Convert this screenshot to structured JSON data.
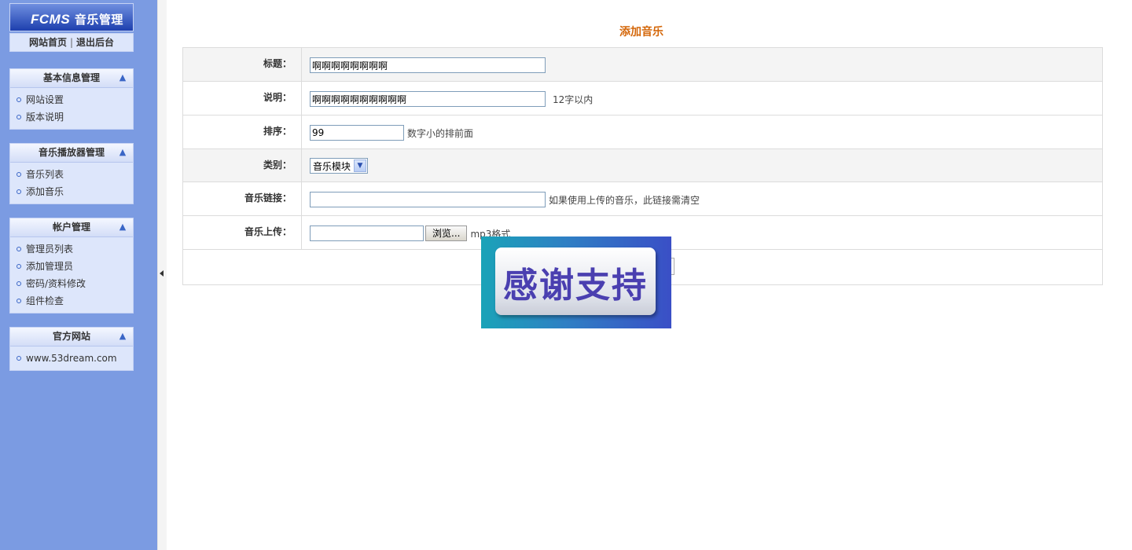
{
  "sidebar": {
    "logo": {
      "brand": "FCMS",
      "suffix": "音乐管理"
    },
    "top_links": {
      "home": "网站首页",
      "separator": "|",
      "logout": "退出后台"
    },
    "panels": [
      {
        "title": "基本信息管理",
        "items": [
          "网站设置",
          "版本说明"
        ]
      },
      {
        "title": "音乐播放器管理",
        "items": [
          "音乐列表",
          "添加音乐"
        ]
      },
      {
        "title": "帐户管理",
        "items": [
          "管理员列表",
          "添加管理员",
          "密码/资料修改",
          "组件检查"
        ]
      },
      {
        "title": "官方网站",
        "items": [
          "www.53dream.com"
        ]
      }
    ],
    "collapse_icon": "up-arrow-icon"
  },
  "main": {
    "page_title": "添加音乐",
    "form": {
      "title_label": "标题：",
      "title_value": "啊啊啊啊啊啊啊啊",
      "desc_label": "说明：",
      "desc_value": "啊啊啊啊啊啊啊啊啊啊",
      "desc_hint": "12字以内",
      "order_label": "排序：",
      "order_value": "99",
      "order_hint": "数字小的排前面",
      "category_label": "类别：",
      "category_selected": "音乐模块",
      "link_label": "音乐链接：",
      "link_value": "",
      "link_hint": "如果使用上传的音乐，此链接需清空",
      "upload_label": "音乐上传：",
      "upload_value": "",
      "browse_label": "浏览...",
      "upload_hint": "mp3格式"
    }
  },
  "overlay": {
    "text": "感谢支持"
  },
  "colors": {
    "sidebar_bg": "#7b9be2",
    "title_color": "#d4670a"
  }
}
